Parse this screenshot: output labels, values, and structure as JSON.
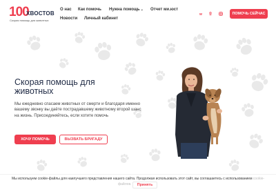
{
  "logo": {
    "number": "100",
    "word": "ХВОСТОВ",
    "tagline": "Скорая помощь для животных"
  },
  "nav": {
    "about": "О нас",
    "how_to_help": "Как помочь",
    "need_help": "Нужна помощь",
    "report": "Отчет ми.юст",
    "news": "Новости",
    "cabinet": "Личный кабинет"
  },
  "header": {
    "help_now": "ПОМОЧЬ СЕЙЧАС"
  },
  "social": [
    "vk-icon",
    "odnoklassniki-icon",
    "instagram-icon"
  ],
  "hero": {
    "title": "Скорая помощь для животных",
    "text": "Мы ежедневно спасаем животных от смерти и благодаря именно вашему звонку вы даёте пострадавшему животному второй шанс на жизнь. Присоединяйтесь, если хотите помочь",
    "btn_help": "ХОЧУ ПОМОЧЬ",
    "btn_call": "ВЫЗВАТЬ БРИГАДУ"
  },
  "cookie": {
    "text": "Мы используем cookie-файлы для наилучшего представления нашего сайта. Продолжая использовать этот сайт, вы соглашаетесь с использованием",
    "link_part1": "cookie-",
    "link_part2": "файлов.",
    "accept": "Принять"
  },
  "colors": {
    "accent": "#ef3e4f",
    "dark": "#1f2a44",
    "paw": "#e9e9e9"
  }
}
